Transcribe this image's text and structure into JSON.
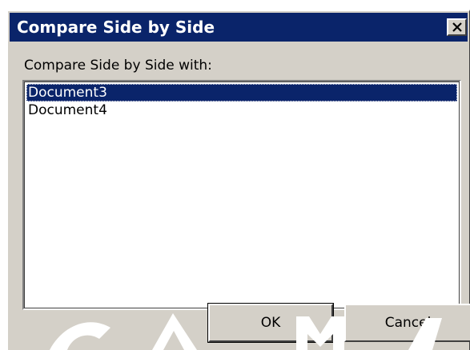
{
  "dialog": {
    "title": "Compare Side by Side",
    "prompt": "Compare Side by Side with:",
    "documents": [
      "Document3",
      "Document4"
    ],
    "selected_document": "Document3",
    "ok_label": "OK",
    "cancel_label": "Cancel",
    "close_icon": "close-icon"
  },
  "colors": {
    "titlebar": "#0a246a",
    "dialog_face": "#d4d0c8",
    "selection": "#0a246a"
  }
}
